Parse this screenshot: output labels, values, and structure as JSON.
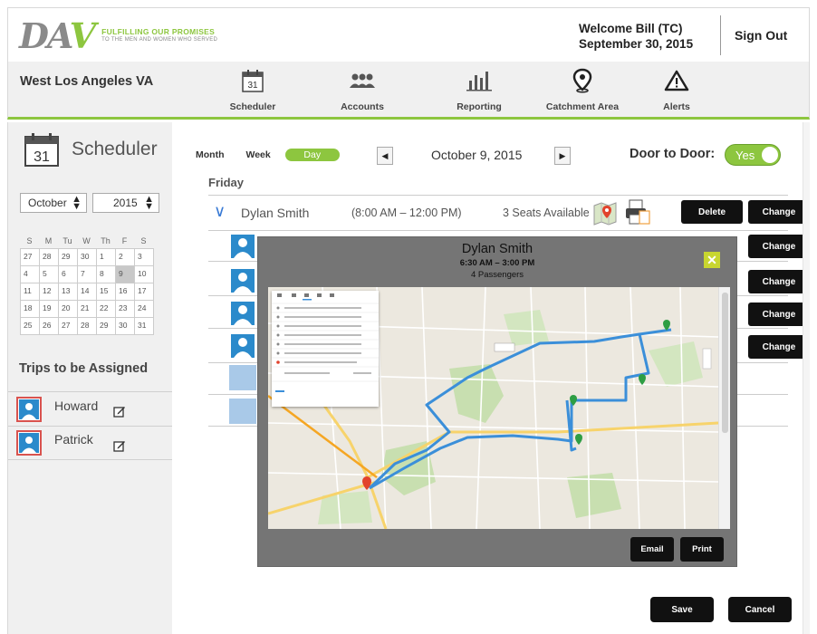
{
  "header": {
    "tagline_line1": "FULFILLING OUR PROMISES",
    "tagline_line2": "TO THE MEN AND WOMEN WHO SERVED",
    "welcome": "Welcome Bill (TC)",
    "date": "September 30, 2015",
    "sign_out": "Sign Out"
  },
  "nav": {
    "site_name": "West Los Angeles VA",
    "items": [
      {
        "label": "Scheduler",
        "icon": "calendar-icon"
      },
      {
        "label": "Accounts",
        "icon": "people-icon"
      },
      {
        "label": "Reporting",
        "icon": "bar-chart-icon"
      },
      {
        "label": "Catchment Area",
        "icon": "map-pin-icon"
      },
      {
        "label": "Alerts",
        "icon": "warning-icon"
      }
    ],
    "calendar_icon_day": "31"
  },
  "sidebar": {
    "title": "Scheduler",
    "calendar_day": "31",
    "month": "October",
    "year": "2015",
    "weekdays": [
      "S",
      "M",
      "Tu",
      "W",
      "Th",
      "F",
      "S"
    ],
    "weeks": [
      [
        "27",
        "28",
        "29",
        "30",
        "1",
        "2",
        "3"
      ],
      [
        "4",
        "5",
        "6",
        "7",
        "8",
        "9",
        "10"
      ],
      [
        "11",
        "12",
        "13",
        "14",
        "15",
        "16",
        "17"
      ],
      [
        "18",
        "19",
        "20",
        "21",
        "22",
        "23",
        "24"
      ],
      [
        "25",
        "26",
        "27",
        "28",
        "29",
        "30",
        "31"
      ]
    ],
    "selected_day": "9",
    "trips_title": "Trips to be Assigned",
    "trips": [
      {
        "name": "Howard"
      },
      {
        "name": "Patrick"
      }
    ]
  },
  "main": {
    "view_month": "Month",
    "view_week": "Week",
    "view_day": "Day",
    "current_date": "October 9, 2015",
    "door_to_door_label": "Door to Door:",
    "door_to_door_value": "Yes",
    "day_name": "Friday",
    "driver": {
      "name": "Dylan Smith",
      "time": "(8:00 AM – 12:00 PM)",
      "seats": "3 Seats Available"
    },
    "delete_label": "Delete",
    "change_label": "Change",
    "save_label": "Save",
    "cancel_label": "Cancel"
  },
  "modal": {
    "name": "Dylan Smith",
    "time": "6:30 AM – 3:00 PM",
    "passengers": "4 Passengers",
    "close_icon": "✕",
    "email_label": "Email",
    "print_label": "Print"
  },
  "colors": {
    "accent_green": "#8dc63f",
    "route_blue": "#3b8fd9",
    "button_black": "#111111"
  }
}
